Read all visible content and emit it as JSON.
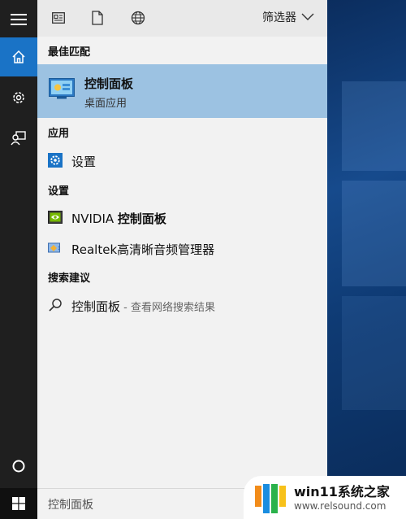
{
  "rail": {
    "items": [
      "menu-icon",
      "home-icon",
      "settings-gear-icon",
      "feedback-person-icon",
      "cortana-circle-icon"
    ]
  },
  "topbar": {
    "icons": [
      "news-icon",
      "document-icon",
      "globe-icon"
    ],
    "filter_label": "筛选器"
  },
  "sections": {
    "best_match": "最佳匹配",
    "apps": "应用",
    "settings": "设置",
    "search_suggestions": "搜索建议"
  },
  "best_match": {
    "name": "控制面板",
    "subtitle": "桌面应用"
  },
  "apps": [
    {
      "label": "设置",
      "icon": "gear-app-icon"
    }
  ],
  "settings_items": [
    {
      "label_prefix": "NVIDIA ",
      "label_bold": "控制面板",
      "icon": "nvidia-icon"
    },
    {
      "label": "Realtek高清晰音频管理器",
      "icon": "realtek-audio-icon"
    }
  ],
  "suggestion": {
    "query": "控制面板",
    "hint": " - 查看网络搜索结果"
  },
  "taskbar": {
    "search_value": "控制面板"
  },
  "watermark": {
    "title": "win11系统之家",
    "url": "www.relsound.com"
  },
  "colors": {
    "accent": "#1a73c6",
    "highlight": "#9cc2e2",
    "rail_bg": "#1f1f1f",
    "panel_bg": "#f2f2f2"
  }
}
